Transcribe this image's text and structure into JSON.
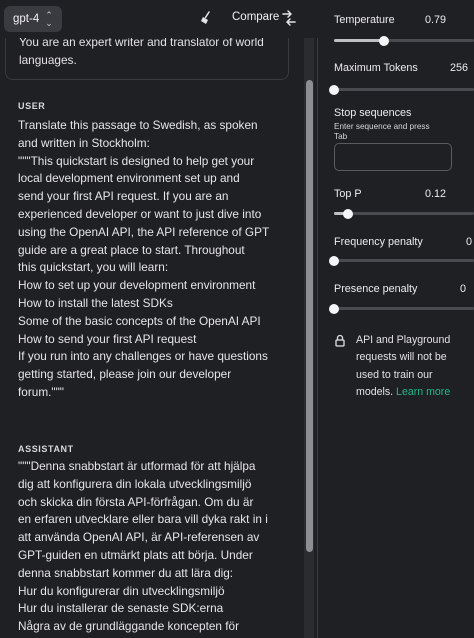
{
  "toolbar": {
    "model": "gpt-4",
    "compare_label": "Compare"
  },
  "system": {
    "lines": [
      "You are an expert writer and translator of world",
      "languages."
    ]
  },
  "messages": [
    {
      "role": "USER",
      "lines": [
        "Translate this passage to Swedish, as spoken",
        "and written in Stockholm:",
        "\"\"\"This quickstart is designed to help get your",
        "local development environment set up and",
        "send your first API request. If you are an",
        "experienced developer or want to just dive into",
        "using the OpenAI API, the API reference of GPT",
        "guide are a great place to start. Throughout",
        "this quickstart, you will learn:",
        "How to set up your development environment",
        "How to install the latest SDKs",
        "Some of the basic concepts of the OpenAI API",
        "How to send your first API request",
        "If you run into any challenges or have questions",
        "getting started, please join our developer",
        "forum.\"\"\""
      ]
    },
    {
      "role": "ASSISTANT",
      "lines": [
        "\"\"\"Denna snabbstart är utformad för att hjälpa",
        "dig att konfigurera din lokala utvecklingsmiljö",
        "och skicka din första API-förfrågan. Om du är",
        "en erfaren utvecklare eller bara vill dyka rakt in i",
        "att använda OpenAI API, är API-referensen av",
        "GPT-guiden en utmärkt plats att börja. Under",
        "denna snabbstart kommer du att lära dig:",
        "Hur du konfigurerar din utvecklingsmiljö",
        "Hur du installerar de senaste SDK:erna",
        "Några av de grundläggande koncepten för"
      ]
    }
  ],
  "params": {
    "temperature": {
      "label": "Temperature",
      "value": "0.79",
      "fraction": 0.36
    },
    "max_tokens": {
      "label": "Maximum Tokens",
      "value": "256",
      "fraction": 0.0
    },
    "stop": {
      "label": "Stop sequences",
      "hint": "Enter sequence and press Tab"
    },
    "top_p": {
      "label": "Top P",
      "value": "0.12",
      "fraction": 0.1
    },
    "frequency": {
      "label": "Frequency penalty",
      "value": "0",
      "fraction": 0.0
    },
    "presence": {
      "label": "Presence penalty",
      "value": "0",
      "fraction": 0.0
    }
  },
  "notice": {
    "text": "API and Playground requests will not be used to train our models. ",
    "link": "Learn more"
  },
  "icons": {
    "chevron": "chevron-updown-icon",
    "clear": "broom-icon",
    "compare": "compare-arrows-icon",
    "lock": "lock-icon"
  }
}
